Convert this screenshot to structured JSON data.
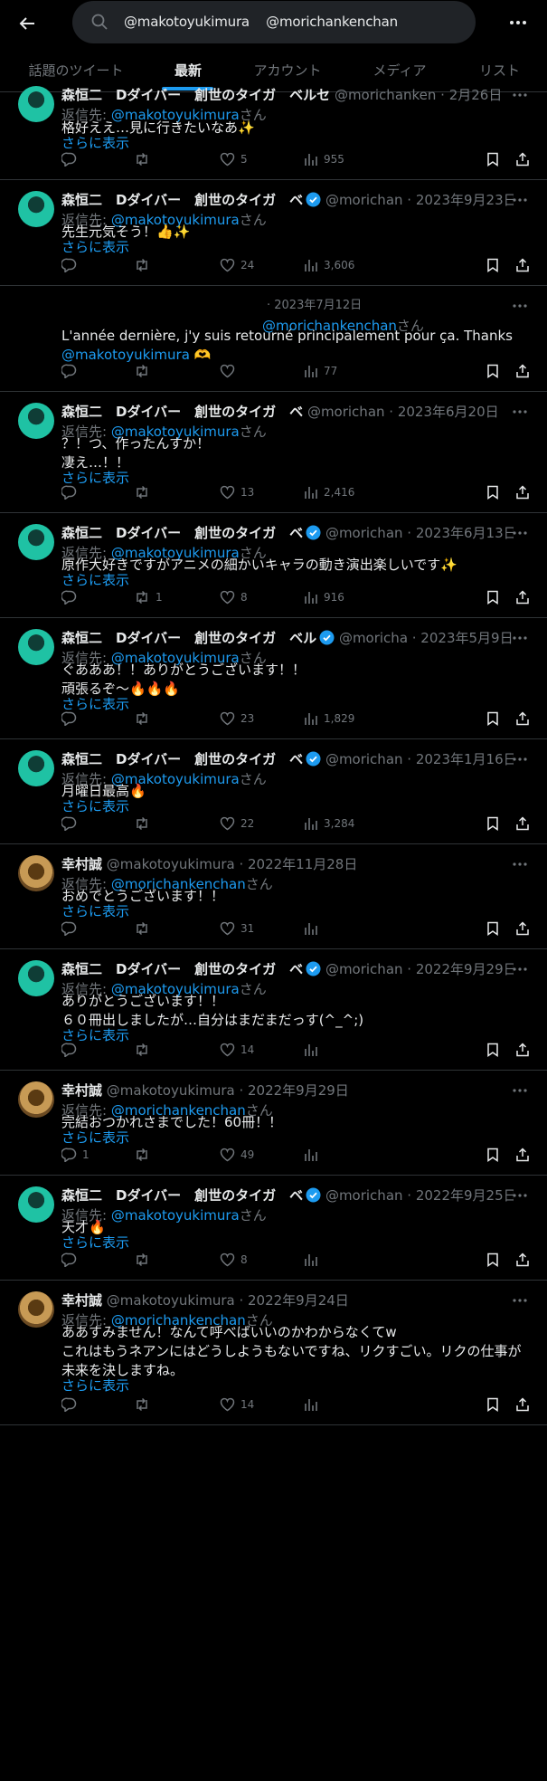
{
  "search": {
    "query": "@makotoyukimura    @morichankenchan"
  },
  "tabs": [
    {
      "label": "話題のツイート"
    },
    {
      "label": "最新"
    },
    {
      "label": "アカウント"
    },
    {
      "label": "メディア"
    },
    {
      "label": "リスト"
    }
  ],
  "colors": {
    "accent": "#1d9bf0",
    "muted": "#71767b",
    "text": "#e7e9ea",
    "border": "#2f3336"
  },
  "reply_prefix": "返信先:",
  "reply_suffix": "さん",
  "show_more": "さらに表示",
  "tweets": [
    {
      "name": "森恒二　Dダイバー　創世のタイガ　ベルセ",
      "verified": false,
      "handle": "@morichanken · 2月26日",
      "reply_to": "@makotoyukimura",
      "text": "格好ええ…見に行きたいなあ✨",
      "show_more": true,
      "replies": "",
      "retweets": "",
      "likes": "5",
      "views": "955"
    },
    {
      "name": "森恒二　Dダイバー　創世のタイガ　ベ",
      "verified": true,
      "handle": "@morichan · 2023年9月23日",
      "reply_to": "@makotoyukimura",
      "text": "先生元気そう！👍✨",
      "show_more": true,
      "replies": "",
      "retweets": "",
      "likes": "24",
      "views": "3,606"
    },
    {
      "redacted": true,
      "handle": "· 2023年7月12日",
      "reply_to": "@morichankenchan",
      "text_before": "L'année dernière, j'y suis retourné principalement pour ça. Thanks",
      "text_mention": "@makotoyukimura",
      "text_after": " 🫶",
      "replies": "",
      "retweets": "",
      "likes": "",
      "views": "77"
    },
    {
      "name": "森恒二　Dダイバー　創世のタイガ　ベ",
      "verified": false,
      "handle": "@morichan · 2023年6月20日",
      "reply_to": "@makotoyukimura",
      "text": "？！つ、作ったんすか！\n凄え…！！",
      "show_more": true,
      "replies": "",
      "retweets": "",
      "likes": "13",
      "views": "2,416"
    },
    {
      "name": "森恒二　Dダイバー　創世のタイガ　ベ",
      "verified": true,
      "handle": "@morichan · 2023年6月13日",
      "reply_to": "@makotoyukimura",
      "text": "原作大好きですがアニメの細かいキャラの動き演出楽しいです✨",
      "show_more": true,
      "replies": "",
      "retweets": "1",
      "likes": "8",
      "views": "916"
    },
    {
      "name": "森恒二　Dダイバー　創世のタイガ　ベル",
      "verified": true,
      "handle": "@moricha · 2023年5月9日",
      "reply_to": "@makotoyukimura",
      "text": "ぐあああ！！ありがとうございます！！\n頑張るぞ〜🔥🔥🔥",
      "show_more": true,
      "replies": "",
      "retweets": "",
      "likes": "23",
      "views": "1,829"
    },
    {
      "name": "森恒二　Dダイバー　創世のタイガ　ベ",
      "verified": true,
      "handle": "@morichan · 2023年1月16日",
      "reply_to": "@makotoyukimura",
      "text": "月曜日最高🔥",
      "show_more": true,
      "replies": "",
      "retweets": "",
      "likes": "22",
      "views": "3,284"
    },
    {
      "name": "幸村誠",
      "verified": false,
      "avatar": "gold",
      "handle": "@makotoyukimura · 2022年11月28日",
      "reply_to": "@morichankenchan",
      "text": "おめでとうございます！！",
      "show_more": true,
      "replies": "",
      "retweets": "",
      "likes": "31",
      "views": ""
    },
    {
      "name": "森恒二　Dダイバー　創世のタイガ　ベ",
      "verified": true,
      "handle": "@morichan · 2022年9月29日",
      "reply_to": "@makotoyukimura",
      "text": "ありがとうございます！！\n６０冊出しましたが…自分はまだまだっす(^_^;)",
      "show_more": true,
      "replies": "",
      "retweets": "",
      "likes": "14",
      "views": ""
    },
    {
      "name": "幸村誠",
      "verified": false,
      "avatar": "gold",
      "handle": "@makotoyukimura · 2022年9月29日",
      "reply_to": "@morichankenchan",
      "text": "完結おつかれさまでした！60冊！！",
      "show_more": true,
      "replies": "1",
      "retweets": "",
      "likes": "49",
      "views": ""
    },
    {
      "name": "森恒二　Dダイバー　創世のタイガ　ベ",
      "verified": true,
      "handle": "@morichan · 2022年9月25日",
      "reply_to": "@makotoyukimura",
      "text": "天才🔥",
      "show_more": true,
      "replies": "",
      "retweets": "",
      "likes": "8",
      "views": ""
    },
    {
      "name": "幸村誠",
      "verified": false,
      "avatar": "gold",
      "handle": "@makotoyukimura · 2022年9月24日",
      "reply_to": "@morichankenchan",
      "text": "ああすみません！なんて呼べばいいのかわからなくてw\nこれはもうネアンにはどうしようもないですね、リクすごい。リクの仕事が未来を決しますね。",
      "show_more": true,
      "replies": "",
      "retweets": "",
      "likes": "14",
      "views": ""
    }
  ]
}
